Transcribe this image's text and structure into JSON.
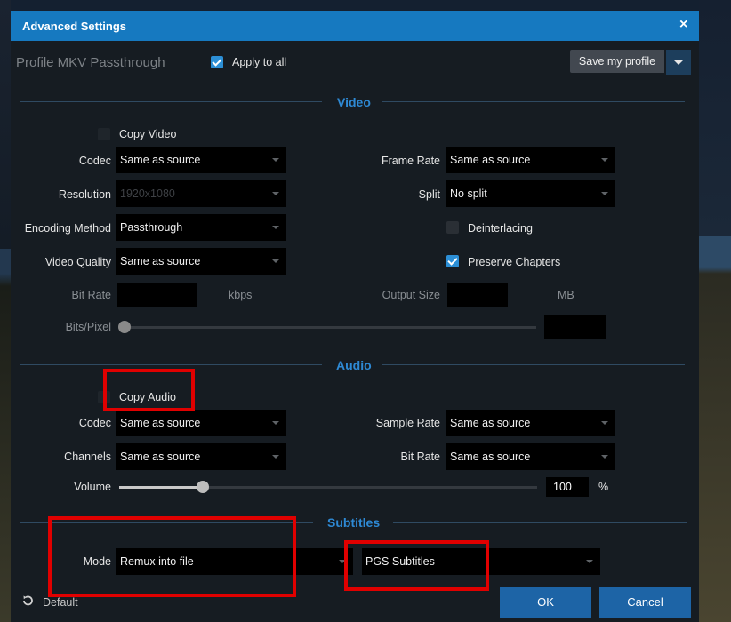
{
  "dialog": {
    "title": "Advanced Settings",
    "close_glyph": "×"
  },
  "header": {
    "profile_label": "Profile MKV Passthrough",
    "apply_to_all_label": "Apply to all",
    "apply_to_all_checked": true,
    "save_profile_label": "Save my profile"
  },
  "video": {
    "section_title": "Video",
    "copy_video_label": "Copy Video",
    "codec_label": "Codec",
    "codec_value": "Same as source",
    "resolution_label": "Resolution",
    "resolution_value": "1920x1080",
    "encoding_label": "Encoding Method",
    "encoding_value": "Passthrough",
    "quality_label": "Video Quality",
    "quality_value": "Same as source",
    "bitrate_label": "Bit Rate",
    "bitrate_unit": "kbps",
    "bitspixel_label": "Bits/Pixel",
    "framerate_label": "Frame Rate",
    "framerate_value": "Same as source",
    "split_label": "Split",
    "split_value": "No split",
    "deinterlacing_label": "Deinterlacing",
    "preserve_chapters_label": "Preserve Chapters",
    "preserve_chapters_checked": true,
    "output_size_label": "Output Size",
    "output_size_unit": "MB"
  },
  "audio": {
    "section_title": "Audio",
    "copy_audio_label": "Copy Audio",
    "codec_label": "Codec",
    "codec_value": "Same as source",
    "channels_label": "Channels",
    "channels_value": "Same as source",
    "sample_rate_label": "Sample Rate",
    "sample_rate_value": "Same as source",
    "bitrate_label": "Bit Rate",
    "bitrate_value": "Same as source",
    "volume_label": "Volume",
    "volume_value": "100",
    "volume_unit": "%",
    "volume_level_fraction": 0.2
  },
  "subtitles": {
    "section_title": "Subtitles",
    "mode_label": "Mode",
    "mode_value": "Remux into file",
    "track_value": "PGS Subtitles"
  },
  "footer": {
    "default_label": "Default",
    "ok_label": "OK",
    "cancel_label": "Cancel"
  },
  "colors": {
    "accent": "#1679c0",
    "section_title": "#2e89d4",
    "annotation_red": "#e00000",
    "button_blue": "#1d64a6"
  },
  "icons": [
    "close-icon",
    "checkbox-icon",
    "dropdown-caret-icon",
    "reset-icon"
  ]
}
